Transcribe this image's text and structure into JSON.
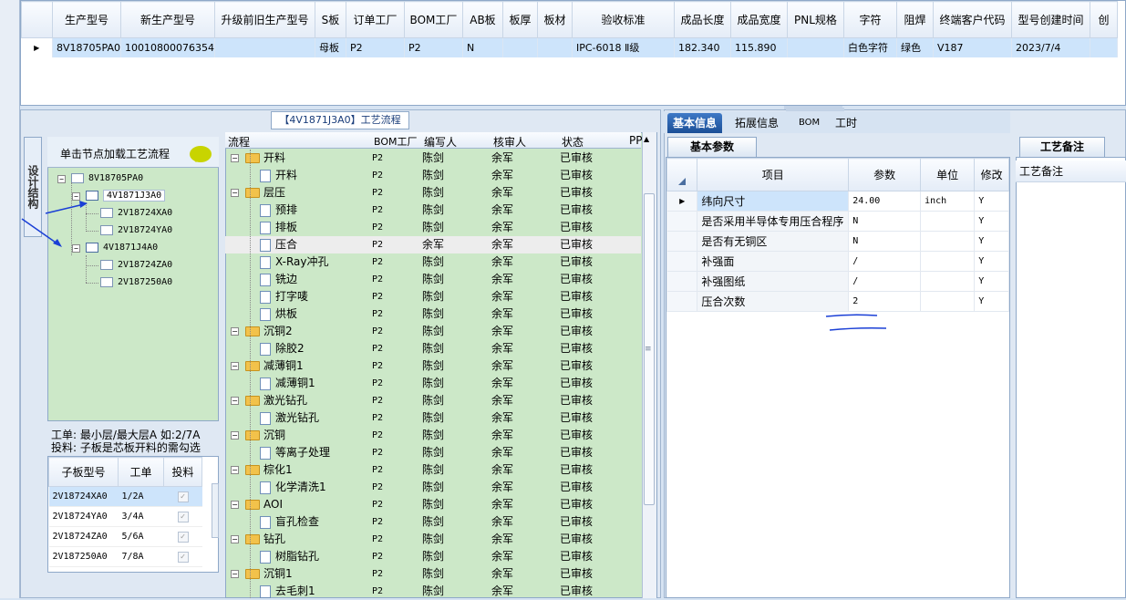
{
  "top_grid": {
    "columns": [
      "生产型号",
      "新生产型号",
      "升级前旧生产型号",
      "S板",
      "订单工厂",
      "BOM工厂",
      "AB板",
      "板厚",
      "板材",
      "验收标准",
      "成品长度",
      "成品宽度",
      "PNL规格",
      "字符",
      "阻焊",
      "终端客户代码",
      "型号创建时间",
      "创"
    ],
    "row": [
      "8V18705PA0",
      "10010800076354",
      "",
      "母板",
      "P2",
      "P2",
      "N",
      "",
      "",
      "IPC-6018 Ⅱ级",
      "182.340",
      "115.890",
      "",
      "白色字符",
      "绿色",
      "V187",
      "2023/7/4",
      ""
    ]
  },
  "flow_panel": {
    "title": "【4V1871J3A0】工艺流程",
    "columns": [
      "流程",
      "BOM工厂",
      "编写人",
      "核审人",
      "状态",
      "PP"
    ],
    "rows": [
      {
        "name": "开料",
        "level": 0,
        "type": "folder",
        "bom": "P2",
        "writer": "陈剑",
        "reviewer": "余军",
        "status": "已审核"
      },
      {
        "name": "开料",
        "level": 1,
        "type": "doc",
        "bom": "P2",
        "writer": "陈剑",
        "reviewer": "余军",
        "status": "已审核"
      },
      {
        "name": "层压",
        "level": 0,
        "type": "folder",
        "bom": "P2",
        "writer": "陈剑",
        "reviewer": "余军",
        "status": "已审核"
      },
      {
        "name": "预排",
        "level": 1,
        "type": "doc",
        "bom": "P2",
        "writer": "陈剑",
        "reviewer": "余军",
        "status": "已审核"
      },
      {
        "name": "排板",
        "level": 1,
        "type": "doc",
        "bom": "P2",
        "writer": "陈剑",
        "reviewer": "余军",
        "status": "已审核"
      },
      {
        "name": "压合",
        "level": 1,
        "type": "doc",
        "bom": "P2",
        "writer": "余军",
        "reviewer": "余军",
        "status": "已审核",
        "selected": true
      },
      {
        "name": "X-Ray冲孔",
        "level": 1,
        "type": "doc",
        "bom": "P2",
        "writer": "陈剑",
        "reviewer": "余军",
        "status": "已审核"
      },
      {
        "name": "铣边",
        "level": 1,
        "type": "doc",
        "bom": "P2",
        "writer": "陈剑",
        "reviewer": "余军",
        "status": "已审核"
      },
      {
        "name": "打字唛",
        "level": 1,
        "type": "doc",
        "bom": "P2",
        "writer": "陈剑",
        "reviewer": "余军",
        "status": "已审核"
      },
      {
        "name": "烘板",
        "level": 1,
        "type": "doc",
        "bom": "P2",
        "writer": "陈剑",
        "reviewer": "余军",
        "status": "已审核"
      },
      {
        "name": "沉铜2",
        "level": 0,
        "type": "folder",
        "bom": "P2",
        "writer": "陈剑",
        "reviewer": "余军",
        "status": "已审核"
      },
      {
        "name": "除胶2",
        "level": 1,
        "type": "doc",
        "bom": "P2",
        "writer": "陈剑",
        "reviewer": "余军",
        "status": "已审核"
      },
      {
        "name": "减薄铜1",
        "level": 0,
        "type": "folder",
        "bom": "P2",
        "writer": "陈剑",
        "reviewer": "余军",
        "status": "已审核"
      },
      {
        "name": "减薄铜1",
        "level": 1,
        "type": "doc",
        "bom": "P2",
        "writer": "陈剑",
        "reviewer": "余军",
        "status": "已审核"
      },
      {
        "name": "激光钻孔",
        "level": 0,
        "type": "folder",
        "bom": "P2",
        "writer": "陈剑",
        "reviewer": "余军",
        "status": "已审核"
      },
      {
        "name": "激光钻孔",
        "level": 1,
        "type": "doc",
        "bom": "P2",
        "writer": "陈剑",
        "reviewer": "余军",
        "status": "已审核"
      },
      {
        "name": "沉铜",
        "level": 0,
        "type": "folder",
        "bom": "P2",
        "writer": "陈剑",
        "reviewer": "余军",
        "status": "已审核"
      },
      {
        "name": "等离子处理",
        "level": 1,
        "type": "doc",
        "bom": "P2",
        "writer": "陈剑",
        "reviewer": "余军",
        "status": "已审核"
      },
      {
        "name": "棕化1",
        "level": 0,
        "type": "folder",
        "bom": "P2",
        "writer": "陈剑",
        "reviewer": "余军",
        "status": "已审核"
      },
      {
        "name": "化学清洗1",
        "level": 1,
        "type": "doc",
        "bom": "P2",
        "writer": "陈剑",
        "reviewer": "余军",
        "status": "已审核"
      },
      {
        "name": "AOI",
        "level": 0,
        "type": "folder",
        "bom": "P2",
        "writer": "陈剑",
        "reviewer": "余军",
        "status": "已审核"
      },
      {
        "name": "盲孔检查",
        "level": 1,
        "type": "doc",
        "bom": "P2",
        "writer": "陈剑",
        "reviewer": "余军",
        "status": "已审核"
      },
      {
        "name": "钻孔",
        "level": 0,
        "type": "folder",
        "bom": "P2",
        "writer": "陈剑",
        "reviewer": "余军",
        "status": "已审核"
      },
      {
        "name": "树脂钻孔",
        "level": 1,
        "type": "doc",
        "bom": "P2",
        "writer": "陈剑",
        "reviewer": "余军",
        "status": "已审核"
      },
      {
        "name": "沉铜1",
        "level": 0,
        "type": "folder",
        "bom": "P2",
        "writer": "陈剑",
        "reviewer": "余军",
        "status": "已审核"
      },
      {
        "name": "去毛刺1",
        "level": 1,
        "type": "doc",
        "bom": "P2",
        "writer": "陈剑",
        "reviewer": "余军",
        "status": "已审核"
      }
    ]
  },
  "structure_tab": "设计结构",
  "tree_header": "单击节点加载工艺流程",
  "tree": [
    {
      "label": "8V18705PA0",
      "level": 0
    },
    {
      "label": "4V1871J3A0",
      "level": 1,
      "selected": true
    },
    {
      "label": "2V18724XA0",
      "level": 2
    },
    {
      "label": "2V18724YA0",
      "level": 2
    },
    {
      "label": "4V1871J4A0",
      "level": 1
    },
    {
      "label": "2V18724ZA0",
      "level": 2
    },
    {
      "label": "2V187250A0",
      "level": 2
    }
  ],
  "info_line1": "工单: 最小层/最大层A 如:2/7A",
  "info_line2": "投料: 子板是芯板开料的需勾选",
  "sub_grid": {
    "columns": [
      "子板型号",
      "工单",
      "投料"
    ],
    "rows": [
      {
        "model": "2V18724XA0",
        "order": "1/2A",
        "checked": true
      },
      {
        "model": "2V18724YA0",
        "order": "3/4A",
        "checked": true
      },
      {
        "model": "2V18724ZA0",
        "order": "5/6A",
        "checked": true
      },
      {
        "model": "2V187250A0",
        "order": "7/8A",
        "checked": true
      }
    ]
  },
  "right_tabs": [
    "基本信息",
    "拓展信息",
    "BOM",
    "工时"
  ],
  "basic_params_tab": "基本参数",
  "param_grid": {
    "columns": [
      "项目",
      "参数",
      "单位",
      "修改"
    ],
    "rows": [
      {
        "item": "纬向尺寸",
        "value": "24.00",
        "unit": "inch",
        "mod": "Y"
      },
      {
        "item": "是否采用半导体专用压合程序",
        "value": "N",
        "unit": "",
        "mod": "Y"
      },
      {
        "item": "是否有无铜区",
        "value": "N",
        "unit": "",
        "mod": "Y"
      },
      {
        "item": "补强面",
        "value": "/",
        "unit": "",
        "mod": "Y"
      },
      {
        "item": "补强图纸",
        "value": "/",
        "unit": "",
        "mod": "Y"
      },
      {
        "item": "压合次数",
        "value": "2",
        "unit": "",
        "mod": "Y"
      }
    ]
  },
  "remark": {
    "tab": "工艺备注",
    "header": "工艺备注"
  },
  "colors": {
    "accent": "#1c4f97",
    "grid_green": "#cce8c8",
    "selected_row": "#cde4fb",
    "annotation_blue": "#1a3fd6"
  }
}
